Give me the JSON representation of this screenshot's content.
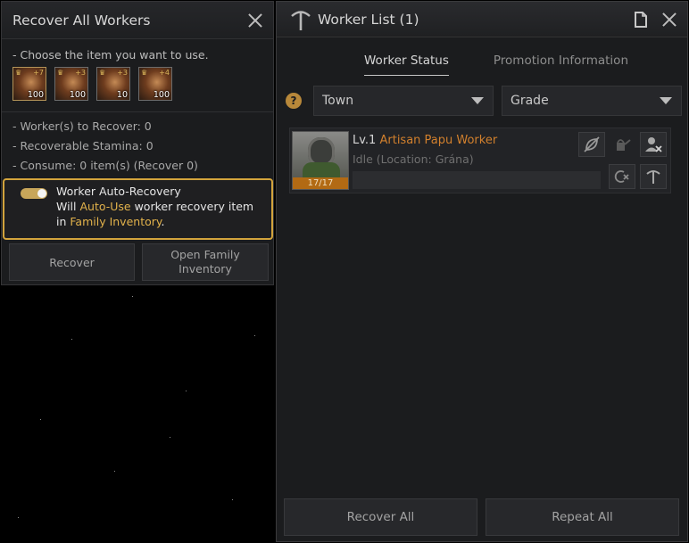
{
  "recover_panel": {
    "title": "Recover All Workers",
    "choose_text": "- Choose the item you want to use.",
    "items": [
      {
        "name": "worker-recovery-item-1",
        "grade": "+7",
        "qty": "100"
      },
      {
        "name": "worker-recovery-item-2",
        "grade": "+3",
        "qty": "100"
      },
      {
        "name": "worker-recovery-item-3",
        "grade": "+3",
        "qty": "10"
      },
      {
        "name": "worker-recovery-item-4",
        "grade": "+4",
        "qty": "100"
      }
    ],
    "stats": [
      "- Worker(s) to Recover: 0",
      "- Recoverable Stamina: 0",
      "- Consume: 0 item(s) (Recover 0)"
    ],
    "auto_recovery": {
      "title": "Worker Auto-Recovery",
      "enabled": true,
      "line1_prefix": "Will ",
      "line1_highlight": "Auto-Use",
      "line1_suffix": " worker recovery item",
      "line2_prefix": "in ",
      "line2_highlight": "Family Inventory",
      "line2_suffix": "."
    },
    "buttons": {
      "recover": "Recover",
      "open_family_inventory": "Open Family Inventory"
    }
  },
  "worker_list": {
    "title": "Worker List (1)",
    "tabs": [
      {
        "label": "Worker Status",
        "active": true
      },
      {
        "label": "Promotion Information",
        "active": false
      }
    ],
    "help_label": "?",
    "filters": {
      "town": "Town",
      "grade": "Grade"
    },
    "workers": [
      {
        "level": "Lv.1",
        "name": "Artisan Papu Worker",
        "status": "Idle (Location: Grána)",
        "stamina": "17/17"
      }
    ],
    "buttons": {
      "recover_all": "Recover All",
      "repeat_all": "Repeat All"
    }
  },
  "colors": {
    "highlight_gold": "#e2b24b",
    "worker_name_orange": "#d2802d",
    "stamina_bar": "#b26a14",
    "auto_box_border": "#d3a43c"
  }
}
